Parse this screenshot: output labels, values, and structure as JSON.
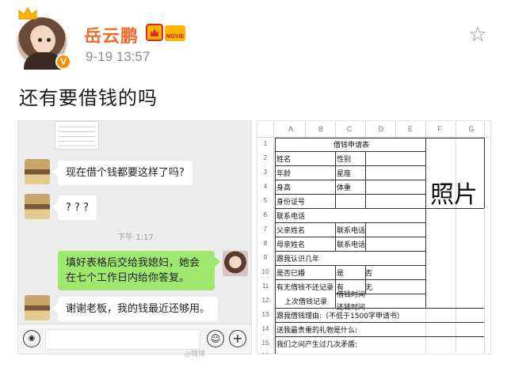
{
  "post": {
    "username": "岳云鹏",
    "badge_movie": "MOVIE",
    "verified_mark": "V",
    "timestamp": "9-19 13:57",
    "text": "还有要借钱的吗",
    "star_icon": "☆"
  },
  "chat": {
    "messages": [
      {
        "side": "left",
        "text": "现在借个钱都要这样了吗?"
      },
      {
        "side": "left",
        "text": "? ? ?"
      },
      {
        "side": "right",
        "text": "填好表格后交给我媳妇，她会在七个工作日内给你答复。"
      },
      {
        "side": "left",
        "text": "谢谢老板，我的钱最近还够用。"
      }
    ],
    "time_divider": "下午 1:17",
    "voice_icon": "◉",
    "emoji_icon": "☺",
    "plus_icon": "+"
  },
  "sheet": {
    "columns": [
      "A",
      "B",
      "C",
      "D",
      "E",
      "F",
      "G"
    ],
    "row_numbers": [
      "1",
      "2",
      "3",
      "4",
      "5",
      "6",
      "7",
      "8",
      "9",
      "10",
      "11",
      "12",
      "13",
      "14",
      "15",
      "16"
    ],
    "title": "借钱申请表",
    "photo": "照片",
    "cells": {
      "name": "姓名",
      "gender": "性别",
      "age": "年龄",
      "zodiac": "星座",
      "height": "身高",
      "weight": "体重",
      "id": "身份证号",
      "phone": "联系电话",
      "father": "父亲姓名",
      "father_phone": "联系电话",
      "mother": "母亲姓名",
      "mother_phone": "联系电话",
      "years": "跟我认识几年",
      "married": "是否已婚",
      "yes1": "是",
      "no1": "否",
      "record": "有无借钱不还记录",
      "yes2": "有",
      "no2": "无",
      "last_loan": "上次借钱记录",
      "loan_time": "借钱时间",
      "return_time": "还钱时间",
      "reason": "跟我借钱理由:（不低于1500字申请书）",
      "gift": "送我最贵重的礼物是什么:",
      "conflict": "我们之间产生过几次矛盾:"
    }
  }
}
